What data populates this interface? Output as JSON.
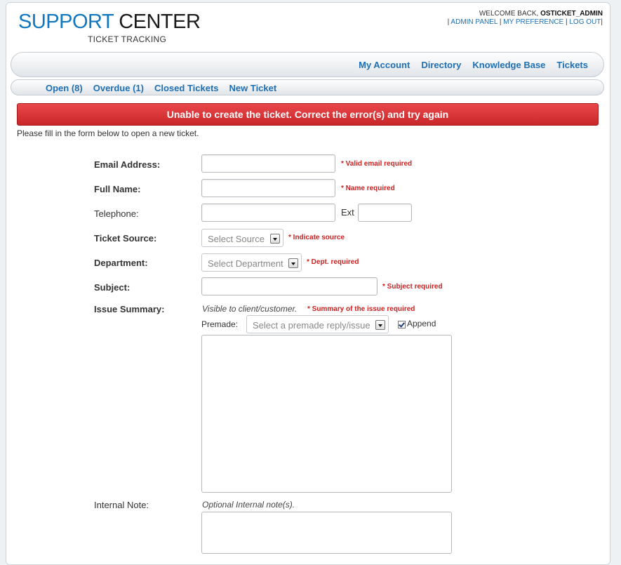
{
  "header": {
    "logo_part1": "SUPPORT",
    "logo_part2": "CENTER",
    "logo_subtitle": "TICKET TRACKING",
    "welcome_prefix": "WELCOME BACK,",
    "username": "OSTICKET_ADMIN",
    "links": [
      "ADMIN PANEL",
      "MY PREFERENCE",
      "LOG OUT"
    ]
  },
  "top_nav": [
    "My Account",
    "Directory",
    "Knowledge Base",
    "Tickets"
  ],
  "sub_nav": [
    "Open (8)",
    "Overdue (1)",
    "Closed Tickets",
    "New Ticket"
  ],
  "error_message": "Unable to create the ticket. Correct the error(s) and try again",
  "intro": "Please fill in the form below to open a new ticket.",
  "form": {
    "email": {
      "label": "Email Address:",
      "value": "",
      "error": "* Valid email required"
    },
    "name": {
      "label": "Full Name:",
      "value": "",
      "error": "* Name required"
    },
    "phone": {
      "label": "Telephone:",
      "value": "",
      "ext_label": "Ext",
      "ext_value": ""
    },
    "source": {
      "label": "Ticket Source:",
      "selected": "Select Source",
      "error": "* Indicate source"
    },
    "department": {
      "label": "Department:",
      "selected": "Select Department",
      "error": "* Dept. required"
    },
    "subject": {
      "label": "Subject:",
      "value": "",
      "error": "* Subject required"
    },
    "issue": {
      "label": "Issue Summary:",
      "hint": "Visible to client/customer.",
      "error": "* Summary of the issue required",
      "premade_label": "Premade:",
      "premade_selected": "Select a premade reply/issue",
      "append_label": "Append",
      "append_checked": true,
      "value": ""
    },
    "internal_note": {
      "label": "Internal Note:",
      "hint": "Optional Internal note(s).",
      "value": ""
    }
  },
  "colors": {
    "link": "#1f6fb3",
    "error_banner": "#d63335",
    "error_text": "#cc1f1f",
    "logo_blue": "#0f78c0"
  }
}
